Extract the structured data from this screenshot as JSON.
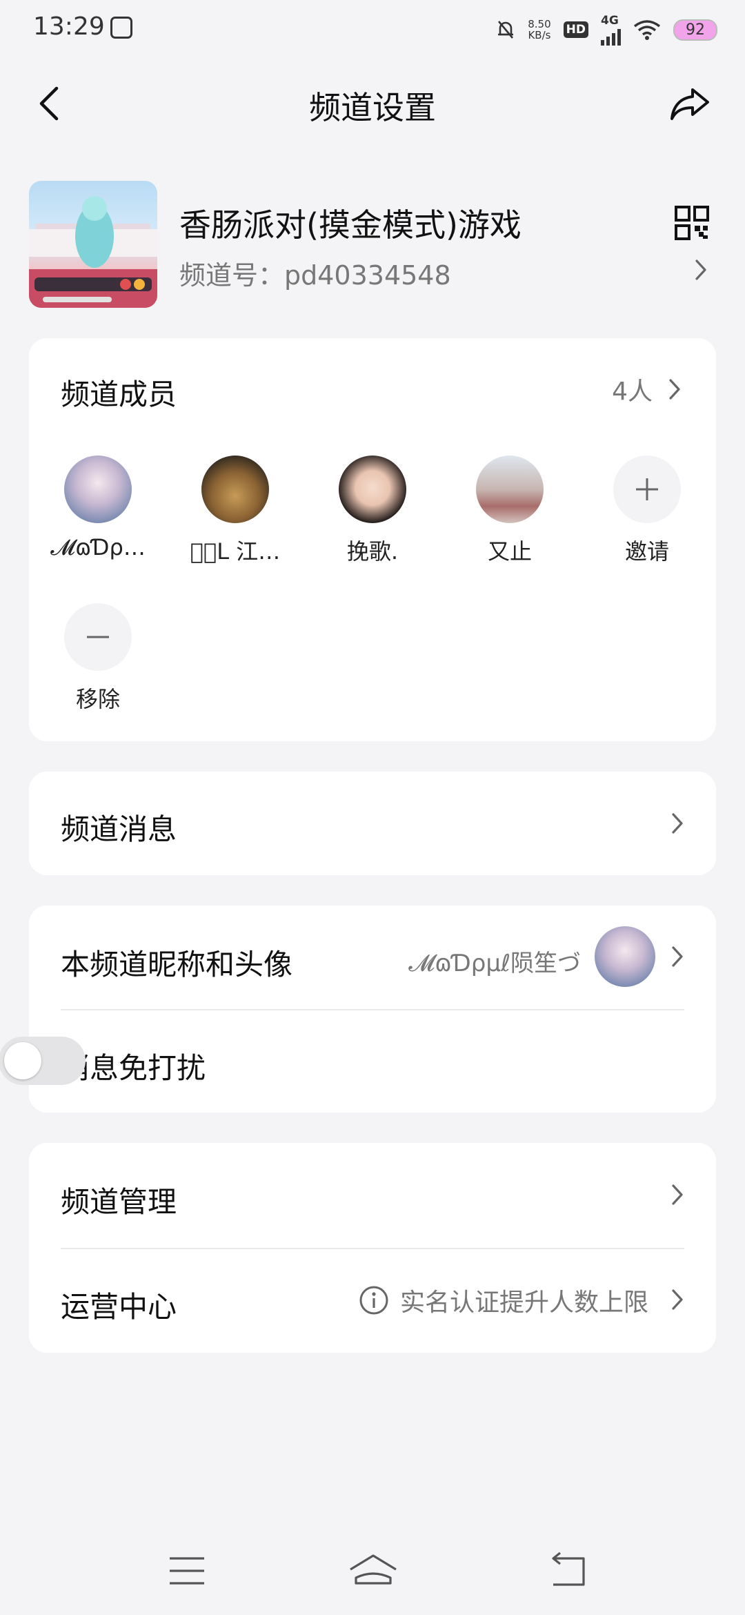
{
  "status_bar": {
    "time": "13:29",
    "net_speed_value": "8.50",
    "net_speed_unit": "KB/s",
    "hd_label": "HD",
    "signal_label": "4G",
    "battery": "92"
  },
  "header": {
    "title": "频道设置"
  },
  "channel": {
    "name": "香肠派对(摸金模式)游戏",
    "id_text": "频道号：pd40334548"
  },
  "members_card": {
    "title": "频道成员",
    "count": "4人",
    "members": [
      {
        "name": "𝓜ɷƊρ…"
      },
      {
        "name": "ঌ⃝ᒪ 江…"
      },
      {
        "name": "挽歌."
      },
      {
        "name": "又止"
      }
    ],
    "invite_label": "邀请",
    "remove_label": "移除"
  },
  "channel_messages": {
    "label": "频道消息"
  },
  "profile_card": {
    "nickname_label": "本频道昵称和头像",
    "nickname_value": "𝓜ɷƊρµℓ陨笙づ",
    "dnd_label": "消息免打扰",
    "dnd_enabled": false
  },
  "manage_card": {
    "manage_label": "频道管理",
    "ops_label": "运营中心",
    "ops_hint": "实名认证提升人数上限"
  },
  "icons": {
    "back": "chevron-left-icon",
    "share": "share-arrow-icon",
    "qr": "qr-code-icon",
    "info": "info-circle-icon",
    "invite": "plus-icon",
    "remove": "minus-icon",
    "nav_menu": "menu-icon",
    "nav_home": "home-icon",
    "nav_back": "back-return-icon"
  },
  "colors": {
    "background": "#f4f4f6",
    "card": "#ffffff",
    "battery": "#f2a4ea"
  }
}
